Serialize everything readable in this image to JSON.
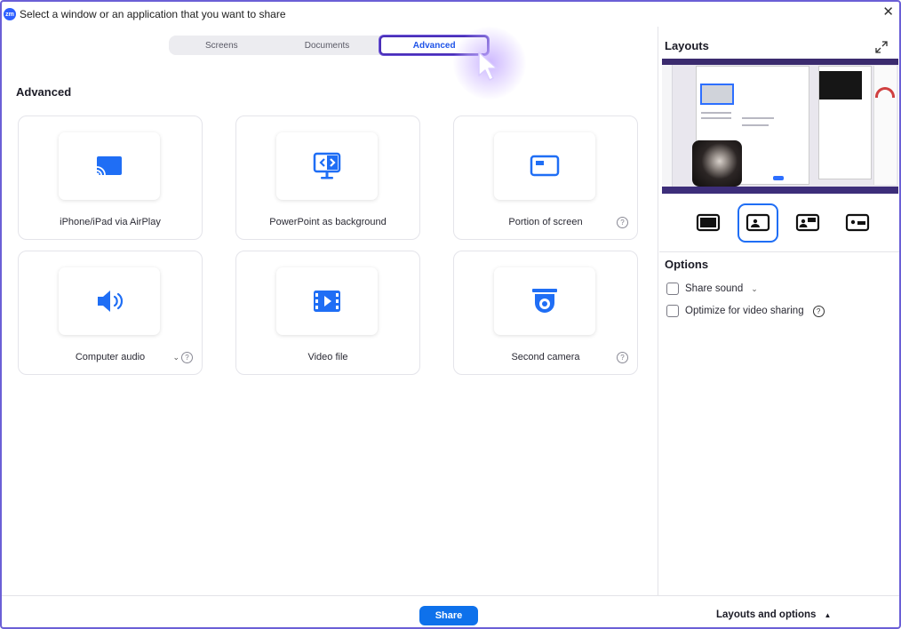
{
  "window": {
    "title": "Select a window or an application that you want to share",
    "app_logo": "zm",
    "close_symbol": "✕"
  },
  "tabs": [
    {
      "label": "Screens",
      "active": false
    },
    {
      "label": "Documents",
      "active": false
    },
    {
      "label": "Advanced",
      "active": true
    }
  ],
  "advanced": {
    "section_title": "Advanced",
    "cards": [
      {
        "label": "iPhone/iPad via AirPlay",
        "icon": "airplay-cast-icon"
      },
      {
        "label": "PowerPoint as background",
        "icon": "powerpoint-background-icon"
      },
      {
        "label": "Portion of screen",
        "icon": "portion-of-screen-icon",
        "help": "?"
      },
      {
        "label": "Computer audio",
        "icon": "speaker-icon",
        "help": "?",
        "caret": "⌄"
      },
      {
        "label": "Video file",
        "icon": "video-file-icon"
      },
      {
        "label": "Second camera",
        "icon": "document-camera-icon",
        "help": "?"
      }
    ]
  },
  "layouts": {
    "title": "Layouts",
    "selected_index": 1,
    "options": [
      "screen-only-layout",
      "picture-in-picture-layout",
      "side-by-side-left-layout",
      "side-by-side-right-layout"
    ]
  },
  "options": {
    "title": "Options",
    "share_sound": {
      "label": "Share sound",
      "checked": false,
      "caret": "⌄"
    },
    "optimize_video": {
      "label": "Optimize for video sharing",
      "checked": false,
      "help": "?"
    }
  },
  "footer": {
    "share_label": "Share",
    "layouts_options_label": "Layouts and options",
    "layouts_options_symbol": "▲"
  },
  "colors": {
    "accent": "#0e71eb",
    "icon_blue": "#1f6ef5",
    "window_border": "#6b5fd6"
  }
}
